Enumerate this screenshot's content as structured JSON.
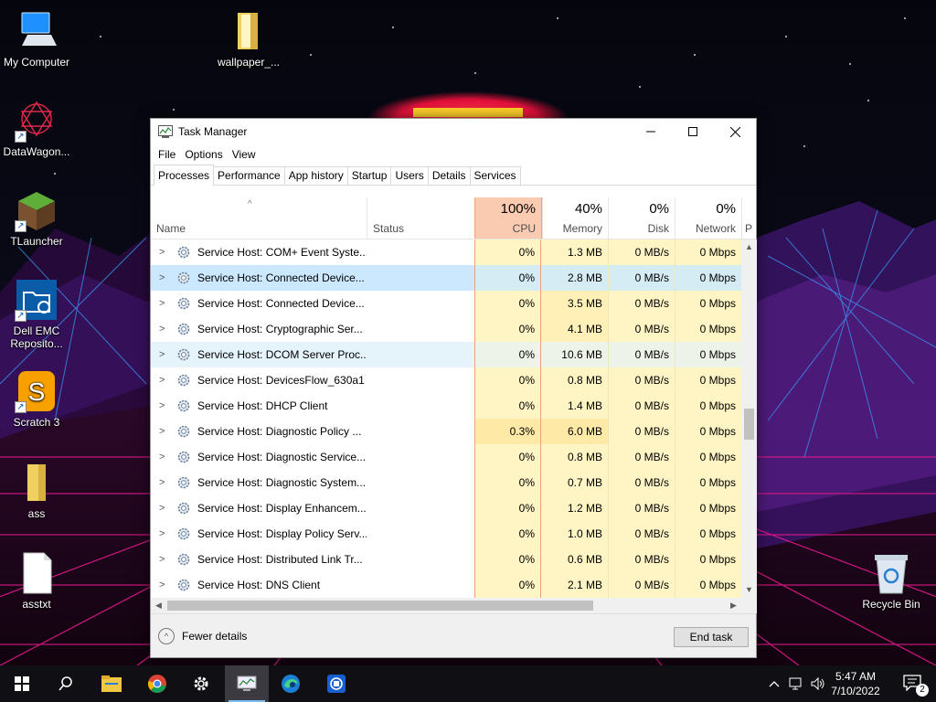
{
  "desktop": {
    "icons": [
      {
        "label": "My Computer",
        "icon": "computer-icon"
      },
      {
        "label": "wallpaper_...",
        "icon": "folder-icon"
      },
      {
        "label": "DataWagon...",
        "icon": "datawagon-icon"
      },
      {
        "label": "TLauncher",
        "icon": "minecraft-block-icon"
      },
      {
        "label": "Dell EMC Reposito...",
        "icon": "folder-network-icon"
      },
      {
        "label": "Scratch 3",
        "icon": "scratch-icon"
      },
      {
        "label": "ass",
        "icon": "folder-icon"
      },
      {
        "label": "asstxt",
        "icon": "text-file-icon"
      },
      {
        "label": "Recycle Bin",
        "icon": "recycle-bin-icon"
      }
    ]
  },
  "window": {
    "title": "Task Manager",
    "menu": [
      "File",
      "Options",
      "View"
    ],
    "tabs": [
      "Processes",
      "Performance",
      "App history",
      "Startup",
      "Users",
      "Details",
      "Services"
    ],
    "active_tab": "Processes"
  },
  "columns": {
    "name": "Name",
    "status": "Status",
    "cpu": {
      "pct": "100%",
      "label": "CPU"
    },
    "memory": {
      "pct": "40%",
      "label": "Memory"
    },
    "disk": {
      "pct": "0%",
      "label": "Disk"
    },
    "network": {
      "pct": "0%",
      "label": "Network"
    },
    "power_partial": "P"
  },
  "rows": [
    {
      "name": "Service Host: COM+ Event Syste...",
      "cpu": "0%",
      "memory": "1.3 MB",
      "disk": "0 MB/s",
      "network": "0 Mbps"
    },
    {
      "name": "Service Host: Connected Device...",
      "cpu": "0%",
      "memory": "2.8 MB",
      "disk": "0 MB/s",
      "network": "0 Mbps"
    },
    {
      "name": "Service Host: Connected Device...",
      "cpu": "0%",
      "memory": "3.5 MB",
      "disk": "0 MB/s",
      "network": "0 Mbps"
    },
    {
      "name": "Service Host: Cryptographic Ser...",
      "cpu": "0%",
      "memory": "4.1 MB",
      "disk": "0 MB/s",
      "network": "0 Mbps"
    },
    {
      "name": "Service Host: DCOM Server Proc...",
      "cpu": "0%",
      "memory": "10.6 MB",
      "disk": "0 MB/s",
      "network": "0 Mbps"
    },
    {
      "name": "Service Host: DevicesFlow_630a1",
      "cpu": "0%",
      "memory": "0.8 MB",
      "disk": "0 MB/s",
      "network": "0 Mbps"
    },
    {
      "name": "Service Host: DHCP Client",
      "cpu": "0%",
      "memory": "1.4 MB",
      "disk": "0 MB/s",
      "network": "0 Mbps"
    },
    {
      "name": "Service Host: Diagnostic Policy ...",
      "cpu": "0.3%",
      "memory": "6.0 MB",
      "disk": "0 MB/s",
      "network": "0 Mbps"
    },
    {
      "name": "Service Host: Diagnostic Service...",
      "cpu": "0%",
      "memory": "0.8 MB",
      "disk": "0 MB/s",
      "network": "0 Mbps"
    },
    {
      "name": "Service Host: Diagnostic System...",
      "cpu": "0%",
      "memory": "0.7 MB",
      "disk": "0 MB/s",
      "network": "0 Mbps"
    },
    {
      "name": "Service Host: Display Enhancem...",
      "cpu": "0%",
      "memory": "1.2 MB",
      "disk": "0 MB/s",
      "network": "0 Mbps"
    },
    {
      "name": "Service Host: Display Policy Serv...",
      "cpu": "0%",
      "memory": "1.0 MB",
      "disk": "0 MB/s",
      "network": "0 Mbps"
    },
    {
      "name": "Service Host: Distributed Link Tr...",
      "cpu": "0%",
      "memory": "0.6 MB",
      "disk": "0 MB/s",
      "network": "0 Mbps"
    },
    {
      "name": "Service Host: DNS Client",
      "cpu": "0%",
      "memory": "2.1 MB",
      "disk": "0 MB/s",
      "network": "0 Mbps"
    }
  ],
  "footer": {
    "fewer_details": "Fewer details",
    "end_task": "End task"
  },
  "taskbar": {
    "time": "5:47 AM",
    "date": "7/10/2022",
    "notification_count": "2"
  },
  "colors": {
    "cpu_header": "#fbcbb1",
    "cell_bg": "#fff4c4",
    "selected_row": "#cce8ff",
    "taskbar": "#101014"
  }
}
